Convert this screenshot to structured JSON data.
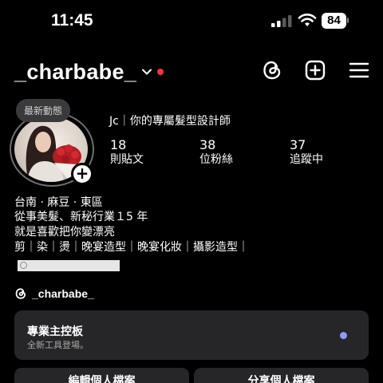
{
  "status_bar": {
    "time": "11:45",
    "battery": "84",
    "icons": [
      "signal-icon",
      "wifi-icon",
      "battery-icon"
    ]
  },
  "header": {
    "username": "_charbabe_",
    "icons": [
      "chevron-down-icon",
      "notification-dot",
      "threads-icon",
      "create-post-icon",
      "menu-icon"
    ],
    "accent_color": "#ff3040"
  },
  "profile": {
    "note_bubble": "最新動態",
    "display_name": "Jc｜你的專屬髮型設計師",
    "stats": [
      {
        "count": "18",
        "label": "則貼文"
      },
      {
        "count": "38",
        "label": "位粉絲"
      },
      {
        "count": "37",
        "label": "追蹤中"
      }
    ]
  },
  "bio": {
    "lines": [
      "台南 · 麻豆 · 東區",
      "從事美髮、新秘行業１5 年",
      "就是喜歡把你變漂亮",
      "剪｜染｜燙｜晚宴造型｜晚宴化妝｜攝影造型｜"
    ]
  },
  "threads_link": "_charbabe_",
  "dashboard": {
    "title": "專業主控板",
    "subtitle": "全新工具登場。",
    "dot_color": "#8c9bff"
  },
  "actions": {
    "edit_profile": "編輯個人檔案",
    "share_profile": "分享個人檔案"
  }
}
